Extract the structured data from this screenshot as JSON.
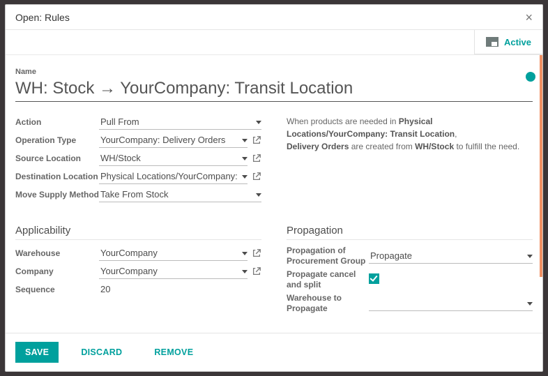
{
  "dialog": {
    "title": "Open: Rules"
  },
  "status": {
    "active_label": "Active"
  },
  "name": {
    "label": "Name",
    "value": "WH: Stock → YourCompany: Transit Location"
  },
  "fields": {
    "action": {
      "label": "Action",
      "value": "Pull From"
    },
    "operation_type": {
      "label": "Operation Type",
      "value": "YourCompany: Delivery Orders"
    },
    "source_location": {
      "label": "Source Location",
      "value": "WH/Stock"
    },
    "destination_location": {
      "label": "Destination Location",
      "value": "Physical Locations/YourCompany: Transit"
    },
    "move_supply": {
      "label": "Move Supply Method",
      "value": "Take From Stock"
    }
  },
  "blurb": {
    "t1": "When products are needed in ",
    "b1": "Physical Locations/YourCompany: Transit Location",
    "t2": ",",
    "b2": "Delivery Orders",
    "t3": " are created from ",
    "b3": "WH/Stock",
    "t4": " to fulfill the need."
  },
  "applicability": {
    "title": "Applicability",
    "warehouse": {
      "label": "Warehouse",
      "value": "YourCompany"
    },
    "company": {
      "label": "Company",
      "value": "YourCompany"
    },
    "sequence": {
      "label": "Sequence",
      "value": "20"
    }
  },
  "propagation": {
    "title": "Propagation",
    "group": {
      "label": "Propagation of Procurement Group",
      "value": "Propagate"
    },
    "cancel_split": {
      "label": "Propagate cancel and split",
      "checked": true
    },
    "wh_to_prop": {
      "label": "Warehouse to Propagate",
      "value": ""
    }
  },
  "footer": {
    "save": "SAVE",
    "discard": "DISCARD",
    "remove": "REMOVE"
  }
}
